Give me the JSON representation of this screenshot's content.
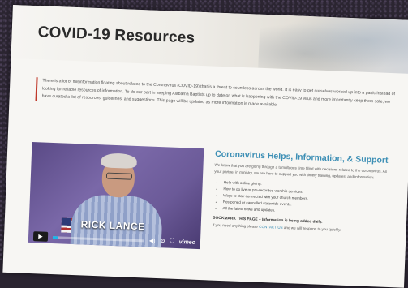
{
  "page": {
    "title": "COVID-19 Resources"
  },
  "notice": {
    "text": "There is a lot of misinformation floating about related to the Coronavirus (COVID-19) that is a threat to countless across the world. It is easy to get ourselves worked up into a panic instead of looking for reliable resources of information. To do our part in keeping Alabama Baptists up to date on what is happening with the COVID-19 virus and more importantly keep them safe, we have curated a list of resources, guidelines, and suggestions. This page will be updated as more information is made available."
  },
  "video": {
    "name_banner": "RICK LANCE",
    "progress_fraction": 0.05,
    "brand": "vimeo"
  },
  "side": {
    "title": "Coronavirus Helps, Information, & Support",
    "intro": "We know that you are going through a tumultuous time filled with decisions related to the coronavirus. As your partner in ministry, we are here to support you with timely training, updates, and information:",
    "items": [
      "Help with online giving.",
      "How to do live or pre-recorded worship services.",
      "Ways to stay connected with your church members.",
      "Postponed or cancelled statewide events.",
      "All the latest news and updates."
    ],
    "bookmark": "BOOKMARK THIS PAGE – Information is being added daily.",
    "contact_prefix": "If you need anything please",
    "contact_link": "CONTACT US",
    "contact_suffix": "and we will respond to you quickly."
  },
  "colors": {
    "accent_blue": "#3d8fb5",
    "notice_border": "#c0392b",
    "video_bg": "#6b5a98"
  }
}
